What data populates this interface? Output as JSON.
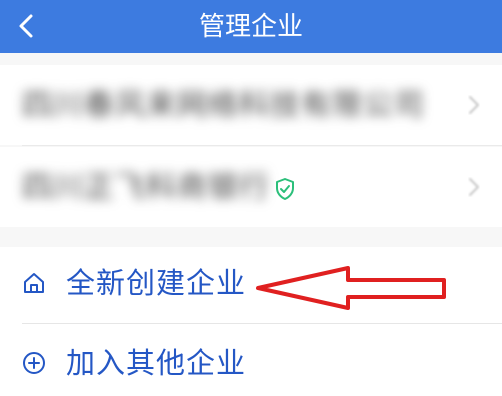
{
  "header": {
    "title": "管理企业",
    "back_icon": "chevron-left-icon",
    "color": "#3d7be0"
  },
  "companies": [
    {
      "name": "四川春风来网络科技有限公司",
      "verified": false
    },
    {
      "name": "四川正飞科商银行",
      "verified": true
    }
  ],
  "actions": {
    "create": {
      "label": "全新创建企业",
      "icon": "home-icon"
    },
    "join": {
      "label": "加入其他企业",
      "icon": "plus-circle-icon"
    }
  },
  "annotation": {
    "color": "#e02020",
    "icon": "red-arrow-left"
  },
  "accent": "#2457c5"
}
